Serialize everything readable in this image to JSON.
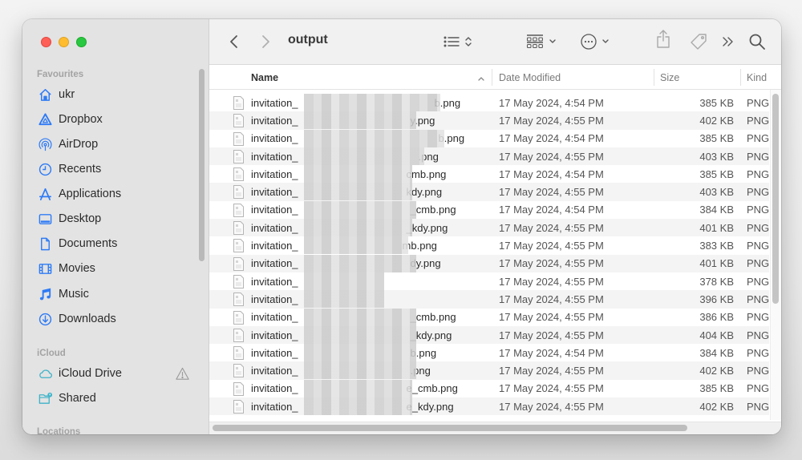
{
  "window": {
    "title": "output"
  },
  "sidebar": {
    "sections": [
      {
        "label": "Favourites",
        "items": [
          {
            "label": "ukr",
            "icon": "home-icon"
          },
          {
            "label": "Dropbox",
            "icon": "dropbox-icon"
          },
          {
            "label": "AirDrop",
            "icon": "airdrop-icon"
          },
          {
            "label": "Recents",
            "icon": "clock-icon"
          },
          {
            "label": "Applications",
            "icon": "applications-icon"
          },
          {
            "label": "Desktop",
            "icon": "desktop-icon"
          },
          {
            "label": "Documents",
            "icon": "document-icon"
          },
          {
            "label": "Movies",
            "icon": "film-icon"
          },
          {
            "label": "Music",
            "icon": "music-note-icon"
          },
          {
            "label": "Downloads",
            "icon": "download-icon"
          }
        ]
      },
      {
        "label": "iCloud",
        "items": [
          {
            "label": "iCloud Drive",
            "icon": "cloud-icon",
            "badge": "warning-icon"
          },
          {
            "label": "Shared",
            "icon": "shared-folder-icon"
          }
        ]
      },
      {
        "label": "Locations",
        "items": []
      }
    ]
  },
  "toolbar": {
    "back": "back-icon",
    "forward": "forward-icon",
    "view_mode": "list-view-icon",
    "group": "group-icon",
    "action": "more-icon",
    "share": "share-icon",
    "tag": "tag-icon",
    "overflow": "overflow-icon",
    "search": "search-icon"
  },
  "table": {
    "columns": {
      "name": "Name",
      "date": "Date Modified",
      "size": "Size",
      "kind": "Kind"
    },
    "rows": [
      {
        "prefix": "invitation_",
        "suffix": "b.png",
        "date": "17 May 2024, 4:54 PM",
        "size": "385 KB",
        "kind": "PNG"
      },
      {
        "prefix": "invitation_",
        "suffix": "y.png",
        "date": "17 May 2024, 4:55 PM",
        "size": "402 KB",
        "kind": "PNG"
      },
      {
        "prefix": "invitation_",
        "suffix": "b.png",
        "date": "17 May 2024, 4:54 PM",
        "size": "385 KB",
        "kind": "PNG"
      },
      {
        "prefix": "invitation_",
        "suffix": ".png",
        "date": "17 May 2024, 4:55 PM",
        "size": "403 KB",
        "kind": "PNG"
      },
      {
        "prefix": "invitation_",
        "suffix": "cmb.png",
        "date": "17 May 2024, 4:54 PM",
        "size": "385 KB",
        "kind": "PNG"
      },
      {
        "prefix": "invitation_",
        "suffix": "kdy.png",
        "date": "17 May 2024, 4:55 PM",
        "size": "403 KB",
        "kind": "PNG"
      },
      {
        "prefix": "invitation_",
        "suffix": "_cmb.png",
        "date": "17 May 2024, 4:54 PM",
        "size": "384 KB",
        "kind": "PNG"
      },
      {
        "prefix": "invitation_",
        "suffix": "_kdy.png",
        "date": "17 May 2024, 4:55 PM",
        "size": "401 KB",
        "kind": "PNG"
      },
      {
        "prefix": "invitation_",
        "suffix": "mb.png",
        "date": "17 May 2024, 4:55 PM",
        "size": "383 KB",
        "kind": "PNG"
      },
      {
        "prefix": "invitation_",
        "suffix": "dy.png",
        "date": "17 May 2024, 4:55 PM",
        "size": "401 KB",
        "kind": "PNG"
      },
      {
        "prefix": "invitation_",
        "suffix": "",
        "date": "17 May 2024, 4:55 PM",
        "size": "378 KB",
        "kind": "PNG"
      },
      {
        "prefix": "invitation_",
        "suffix": "",
        "date": "17 May 2024, 4:55 PM",
        "size": "396 KB",
        "kind": "PNG"
      },
      {
        "prefix": "invitation_",
        "suffix": "_cmb.png",
        "date": "17 May 2024, 4:55 PM",
        "size": "386 KB",
        "kind": "PNG"
      },
      {
        "prefix": "invitation_",
        "suffix": "_kdy.png",
        "date": "17 May 2024, 4:55 PM",
        "size": "404 KB",
        "kind": "PNG"
      },
      {
        "prefix": "invitation_",
        "suffix": "b.png",
        "date": "17 May 2024, 4:54 PM",
        "size": "384 KB",
        "kind": "PNG"
      },
      {
        "prefix": "invitation_",
        "suffix": ".png",
        "date": "17 May 2024, 4:55 PM",
        "size": "402 KB",
        "kind": "PNG"
      },
      {
        "prefix": "invitation_",
        "suffix": "e_cmb.png",
        "date": "17 May 2024, 4:55 PM",
        "size": "385 KB",
        "kind": "PNG"
      },
      {
        "prefix": "invitation_",
        "suffix": "e_kdy.png",
        "date": "17 May 2024, 4:55 PM",
        "size": "402 KB",
        "kind": "PNG"
      }
    ]
  },
  "colors": {
    "accent": "#2f7bf5",
    "icloud": "#3fb3c8"
  }
}
